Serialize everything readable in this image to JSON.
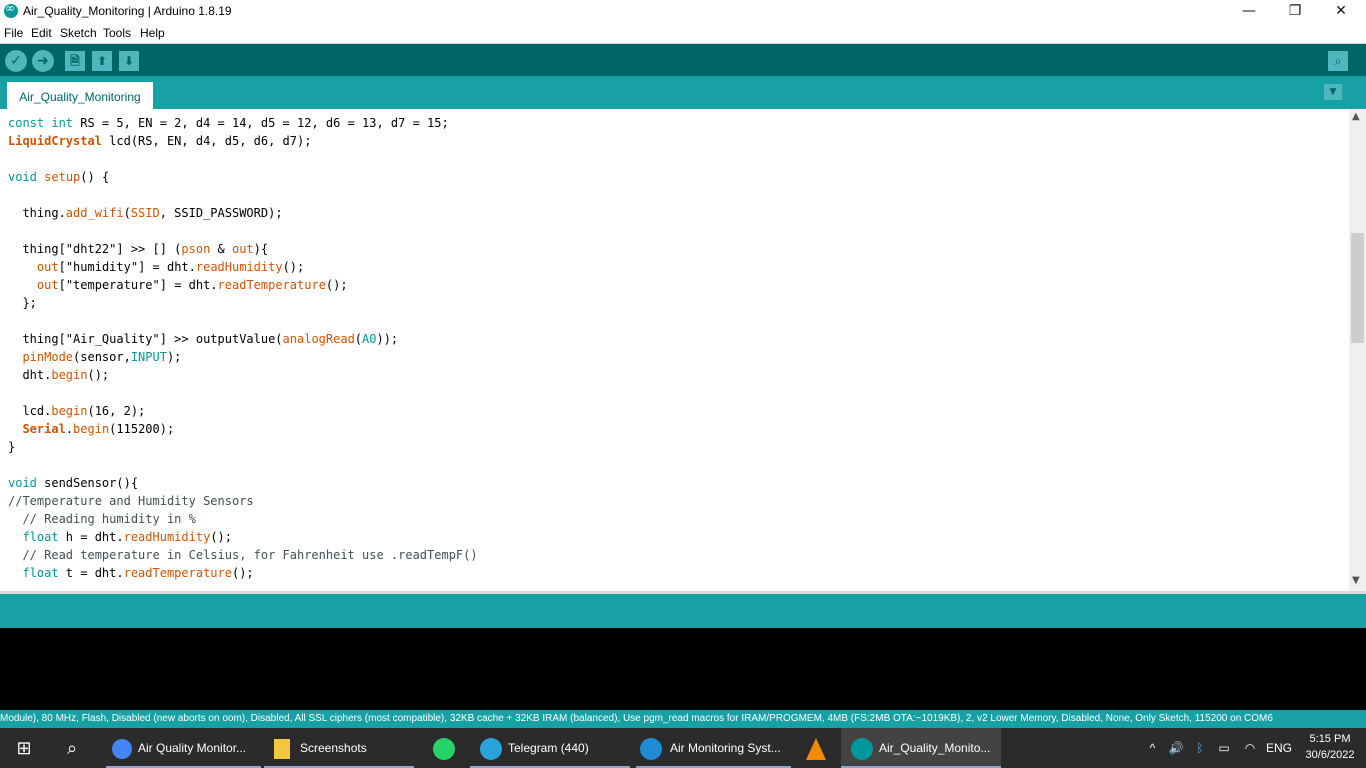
{
  "window": {
    "title": "Air_Quality_Monitoring | Arduino 1.8.19",
    "minimize": "—",
    "restore": "❐",
    "close": "✕"
  },
  "menu": [
    "File",
    "Edit",
    "Sketch",
    "Tools",
    "Help"
  ],
  "toolbar": {
    "verify_icon": "✓",
    "upload_icon": "➜",
    "new_icon": "🗎",
    "open_icon": "⬆",
    "save_icon": "⬇",
    "serial_monitor_icon": "⌕"
  },
  "tab": {
    "name": "Air_Quality_Monitoring",
    "menu_icon": "▼"
  },
  "code": [
    "const int RS = 5, EN = 2, d4 = 14, d5 = 12, d6 = 13, d7 = 15;",
    "LiquidCrystal lcd(RS, EN, d4, d5, d6, d7);",
    "",
    "void setup() {",
    "",
    "  thing.add_wifi(SSID, SSID_PASSWORD);",
    "",
    "  thing[\"dht22\"] >> [] (pson & out){",
    "    out[\"humidity\"] = dht.readHumidity();",
    "    out[\"temperature\"] = dht.readTemperature();",
    "  };",
    "",
    "  thing[\"Air_Quality\"] >> outputValue(analogRead(A0));",
    "  pinMode(sensor,INPUT);",
    "  dht.begin();",
    "",
    "  lcd.begin(16, 2);",
    "  Serial.begin(115200);",
    "}",
    "",
    "void sendSensor(){",
    "//Temperature and Humidity Sensors",
    "  // Reading humidity in %",
    "  float h = dht.readHumidity();",
    "  // Read temperature in Celsius, for Fahrenheit use .readTempF()",
    "  float t = dht.readTemperature();"
  ],
  "status_line": "Module), 80 MHz, Flash, Disabled (new aborts on oom), Disabled, All SSL ciphers (most compatible), 32KB cache + 32KB IRAM (balanced), Use pgm_read macros for IRAM/PROGMEM, 4MB (FS:2MB OTA:~1019KB), 2, v2 Lower Memory, Disabled, None, Only Sketch, 115200 on COM6",
  "taskbar": {
    "items": [
      {
        "label": "Air Quality Monitor...",
        "color": "#4285f4"
      },
      {
        "label": "Screenshots",
        "color": "#f4c542"
      },
      {
        "label": "",
        "color": "#25d366"
      },
      {
        "label": "Telegram (440)",
        "color": "#2aa3dd"
      },
      {
        "label": "Air Monitoring Syst...",
        "color": "#1f8ad6"
      },
      {
        "label": "",
        "color": "#f08a00"
      },
      {
        "label": "Air_Quality_Monito...",
        "color": "#00979c"
      }
    ],
    "language": "ENG",
    "time": "5:15 PM",
    "date": "30/6/2022"
  }
}
